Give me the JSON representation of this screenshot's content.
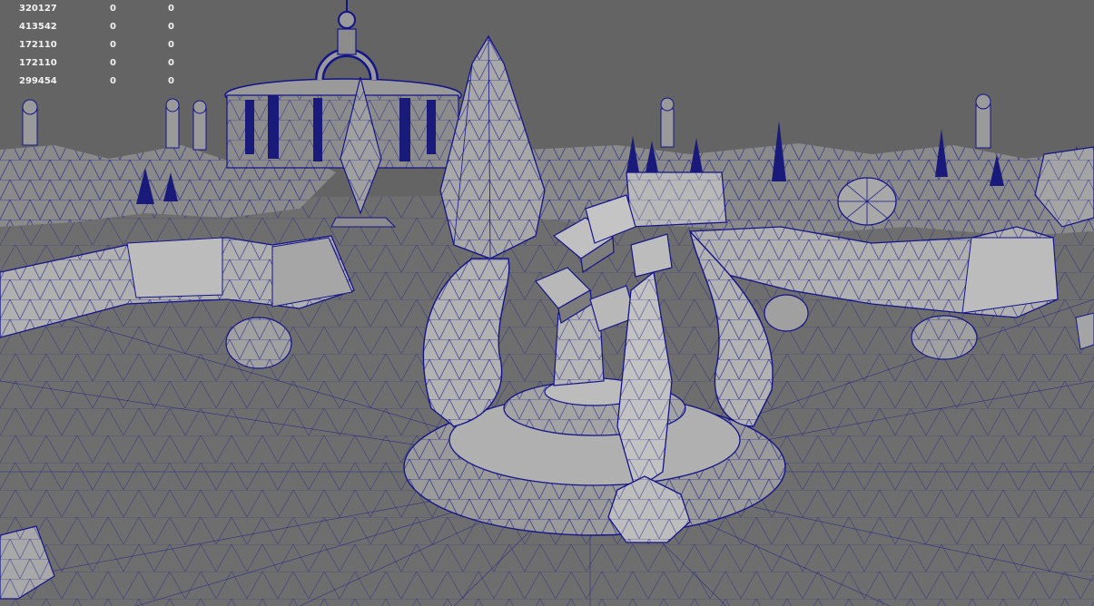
{
  "viewport": {
    "background": "#646464",
    "wire_color": "#14148a",
    "shade_light": "#b4b4b4",
    "shade_mid": "#969696",
    "shade_dark": "#7a7a7a"
  },
  "heads_up_display": {
    "rows": [
      [
        "320127",
        "0",
        "0"
      ],
      [
        "413542",
        "0",
        "0"
      ],
      [
        "172110",
        "0",
        "0"
      ],
      [
        "172110",
        "0",
        "0"
      ],
      [
        "299454",
        "0",
        "0"
      ]
    ]
  }
}
